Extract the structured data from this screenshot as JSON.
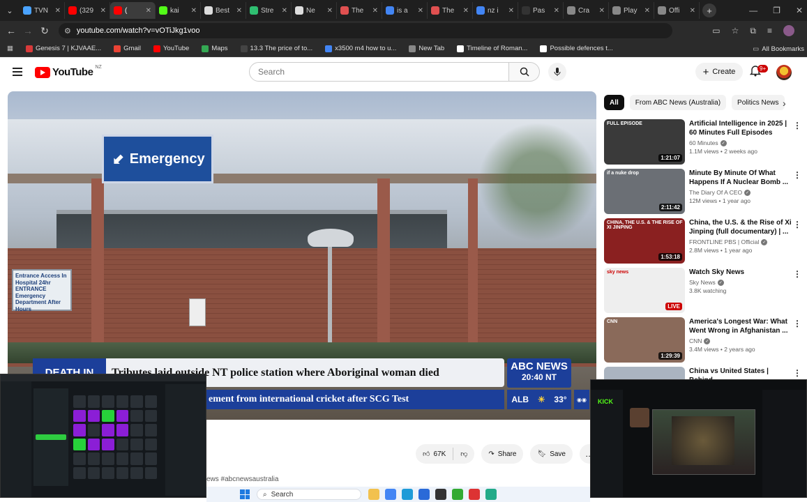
{
  "browser": {
    "menu_icon": "chevron-down-icon",
    "tabs": [
      {
        "title": "TVN",
        "color": "#4aa3ff"
      },
      {
        "title": "(329",
        "color": "#ff0000"
      },
      {
        "title": "(",
        "color": "#ff0000",
        "active": true
      },
      {
        "title": "kai",
        "color": "#53fc18"
      },
      {
        "title": "Best",
        "color": "#dddddd"
      },
      {
        "title": "Stre",
        "color": "#2fbf71"
      },
      {
        "title": "Ne",
        "color": "#dddddd"
      },
      {
        "title": "The",
        "color": "#e05050"
      },
      {
        "title": "is a",
        "color": "#4285f4"
      },
      {
        "title": "The",
        "color": "#e05050"
      },
      {
        "title": "nz i",
        "color": "#4285f4"
      },
      {
        "title": "Pas",
        "color": "#333333"
      },
      {
        "title": "Cra",
        "color": "#888888"
      },
      {
        "title": "Play",
        "color": "#888888"
      },
      {
        "title": "Offi",
        "color": "#888888"
      }
    ],
    "new_tab": "+",
    "url": "youtube.com/watch?v=vOTiJkg1voo"
  },
  "bookmarks": {
    "items": [
      {
        "label": "Genesis 7 | KJVAAE...",
        "color": "#d83a3a"
      },
      {
        "label": "Gmail",
        "color": "#ea4335"
      },
      {
        "label": "YouTube",
        "color": "#ff0000"
      },
      {
        "label": "Maps",
        "color": "#34a853"
      },
      {
        "label": "13.3 The price of to...",
        "color": "#444444"
      },
      {
        "label": "x3500 m4 how to u...",
        "color": "#4285f4"
      },
      {
        "label": "New Tab",
        "color": "#888888"
      },
      {
        "label": "Timeline of Roman...",
        "color": "#ffffff"
      },
      {
        "label": "Possible defences t...",
        "color": "#ffffff"
      }
    ],
    "all_label": "All Bookmarks"
  },
  "youtube": {
    "logo_text": "YouTube",
    "region": "NZ",
    "search_placeholder": "Search",
    "create_label": "Create",
    "notif_badge": "9+"
  },
  "video": {
    "emergency_sign": "Emergency",
    "entrance_sign": "Entrance Access In Hospital 24hr ENTRANCE Emergency Department After Hours",
    "lower_third_tag": "DEATH IN",
    "headline": "Tributes laid outside NT police station where Aboriginal woman died",
    "ticker": "ement from international cricket after SCG Test",
    "brand": "ABC NEWS",
    "time": "20:40 NT",
    "weather_city": "ALB",
    "weather_temp": "33°"
  },
  "actions": {
    "likes": "67K",
    "share": "Share",
    "save": "Save",
    "more": "…"
  },
  "description": {
    "hashtags": "ews #abcnewsaustralia"
  },
  "chips": [
    "All",
    "From ABC News (Australia)",
    "Politics News"
  ],
  "recommendations": [
    {
      "title": "Artificial Intelligence in 2025 | 60 Minutes Full Episodes",
      "channel": "60 Minutes",
      "verified": true,
      "views": "1.1M views • 2 weeks ago",
      "duration": "1:21:07",
      "badge": "FULL EPISODE",
      "thumb": "#3a3a3a"
    },
    {
      "title": "Minute By Minute Of What Happens If A Nuclear Bomb ...",
      "channel": "The Diary Of A CEO",
      "verified": true,
      "views": "12M views • 1 year ago",
      "duration": "2:11:42",
      "badge": "if a nuke drop",
      "thumb": "#6b6f75"
    },
    {
      "title": "China, the U.S. & the Rise of Xi Jinping (full documentary) | ...",
      "channel": "FRONTLINE PBS | Official",
      "verified": true,
      "views": "2.8M views • 1 year ago",
      "duration": "1:53:18",
      "badge": "CHINA, THE U.S. & THE RISE OF XI JINPING",
      "thumb": "#8a2020"
    },
    {
      "title": "Watch Sky News",
      "channel": "Sky News",
      "verified": true,
      "views": "3.8K watching",
      "duration": "LIVE",
      "badge": "sky news",
      "thumb": "#eeeeee",
      "live": true
    },
    {
      "title": "America's Longest War: What Went Wrong in Afghanistan ...",
      "channel": "CNN",
      "verified": true,
      "views": "3.4M views • 2 years ago",
      "duration": "1:29:39",
      "badge": "CNN",
      "thumb": "#8a6a5a"
    },
    {
      "title": "China vs United States | Behind",
      "channel": "",
      "verified": false,
      "views": "",
      "duration": "",
      "badge": "",
      "thumb": "#aab4c0"
    }
  ],
  "overlay_right": {
    "brand": "KICK"
  },
  "taskbar": {
    "search_label": "Search"
  }
}
